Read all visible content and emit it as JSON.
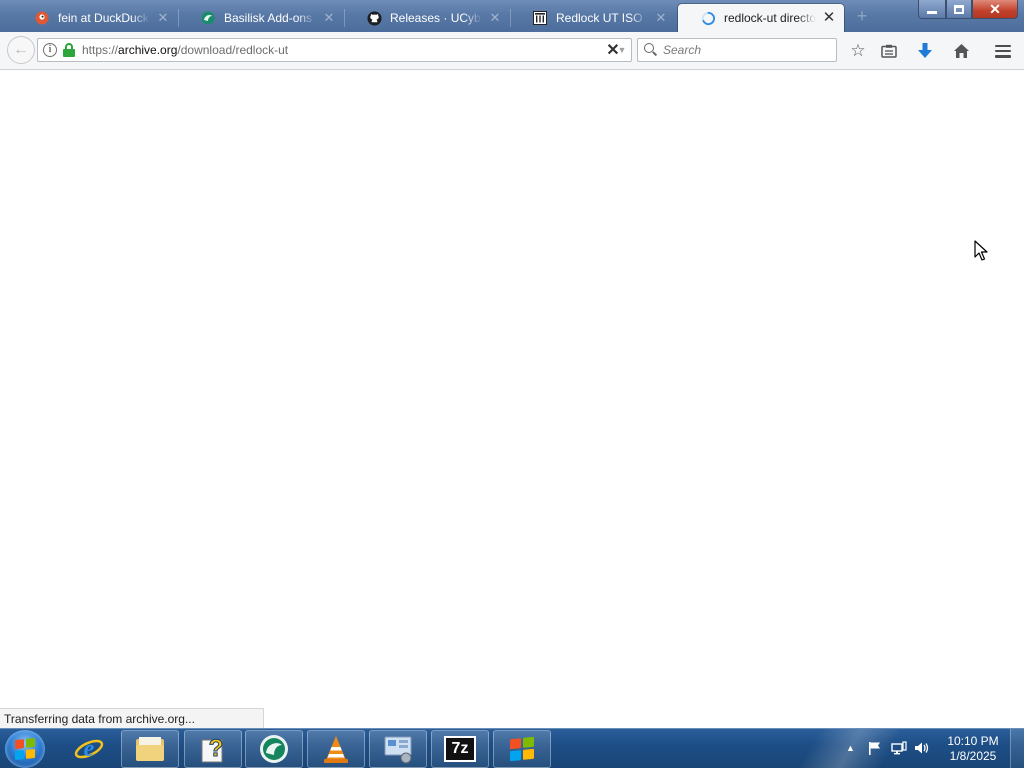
{
  "browser": {
    "tabs": [
      {
        "title": "fein at DuckDuckGo",
        "icon": "duckduckgo-icon"
      },
      {
        "title": "Basilisk Add-ons - Basilisk",
        "icon": "basilisk-icon"
      },
      {
        "title": "Releases · UCyborg",
        "icon": "github-icon"
      },
      {
        "title": "Redlock UT ISO : Internet Archive",
        "icon": "archive-icon"
      },
      {
        "title": "redlock-ut directory listing",
        "icon": "loading-spinner-icon"
      }
    ],
    "new_tab": "+",
    "window_controls": {
      "minimize": "–",
      "maximize": "❐",
      "close": "✕"
    },
    "url": {
      "prefix": "https://",
      "host": "archive.org",
      "path": "/download/redlock-ut"
    },
    "search": {
      "placeholder": "Search",
      "value": ""
    },
    "status": "Transferring data from archive.org..."
  },
  "taskbar": {
    "pinned": [
      {
        "name": "internet-explorer-icon"
      },
      {
        "name": "file-explorer-icon"
      },
      {
        "name": "help-icon"
      },
      {
        "name": "basilisk-icon"
      },
      {
        "name": "vlc-icon"
      },
      {
        "name": "control-panel-icon"
      },
      {
        "name": "7zip-icon",
        "label": "7z"
      },
      {
        "name": "windows-update-icon"
      }
    ],
    "clock": {
      "time": "10:10 PM",
      "date": "1/8/2025"
    }
  },
  "colors": {
    "accent_download": "#1f7ad8",
    "lock_green": "#2ca53b",
    "taskbar": "#1d4e86",
    "close_red": "#c2412b"
  }
}
